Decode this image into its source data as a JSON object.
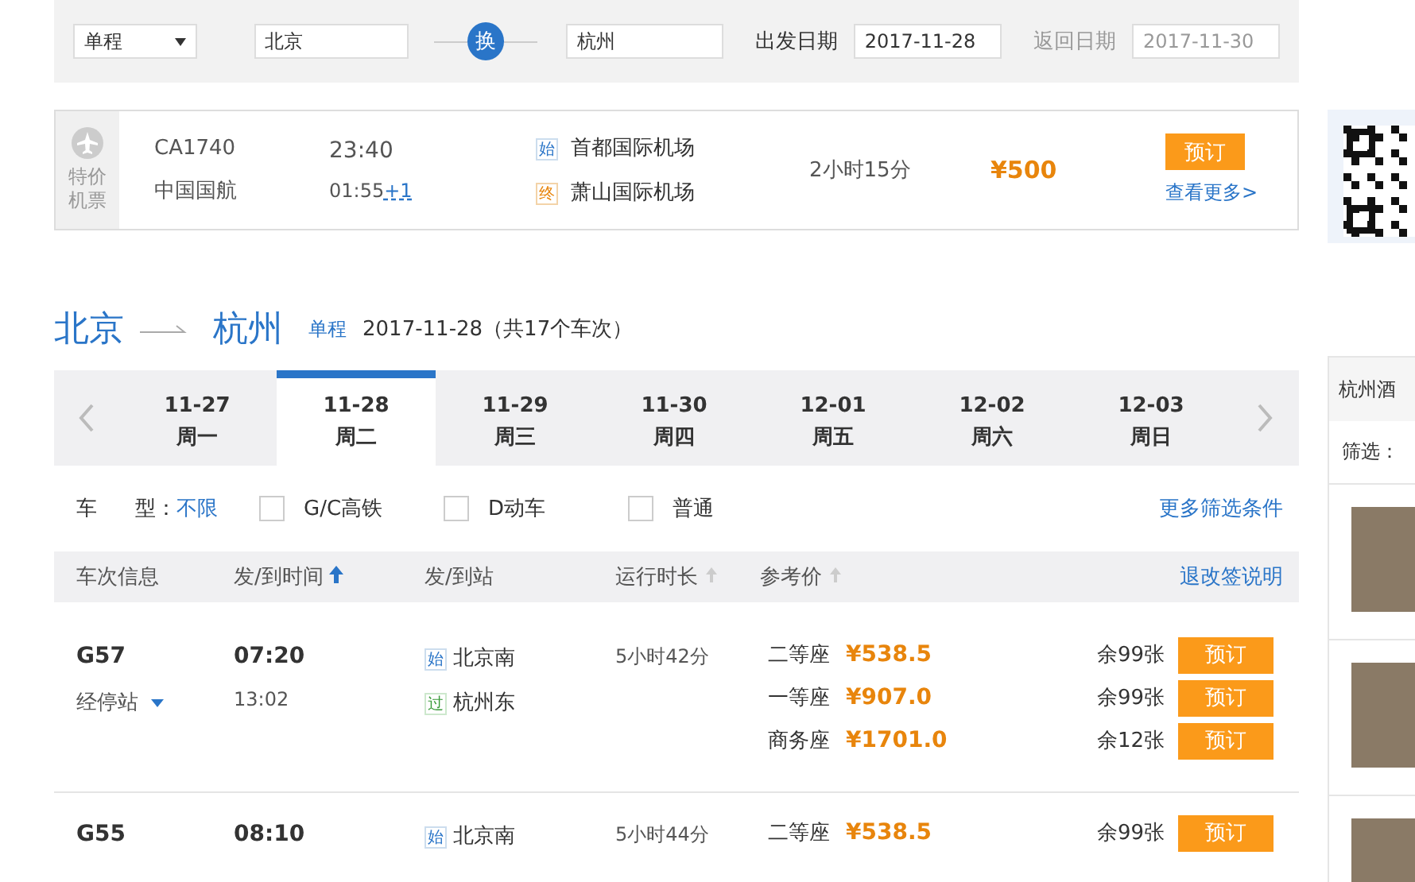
{
  "search": {
    "trip_type": "单程",
    "from": "北京",
    "swap": "换",
    "to": "杭州",
    "depart_label": "出发日期",
    "depart_date": "2017-11-28",
    "return_label": "返回日期",
    "return_date": "2017-11-30"
  },
  "flight_ad": {
    "badge": "特价机票",
    "flight_no": "CA1740",
    "airline": "中国国航",
    "depart_time": "23:40",
    "arrive_time": "01:55",
    "next_day": "+1",
    "from_tag": "始",
    "from_airport": "首都国际机场",
    "to_tag": "终",
    "to_airport": "萧山国际机场",
    "duration": "2小时15分",
    "price": "¥500",
    "book": "预订",
    "more": "查看更多>"
  },
  "route": {
    "from": "北京",
    "to": "杭州",
    "trip_type": "单程",
    "summary": "2017-11-28（共17个车次）"
  },
  "date_tabs": [
    {
      "date": "11-27",
      "weekday": "周一",
      "selected": false
    },
    {
      "date": "11-28",
      "weekday": "周二",
      "selected": true
    },
    {
      "date": "11-29",
      "weekday": "周三",
      "selected": false
    },
    {
      "date": "11-30",
      "weekday": "周四",
      "selected": false
    },
    {
      "date": "12-01",
      "weekday": "周五",
      "selected": false
    },
    {
      "date": "12-02",
      "weekday": "周六",
      "selected": false
    },
    {
      "date": "12-03",
      "weekday": "周日",
      "selected": false
    }
  ],
  "filters": {
    "label_1": "车",
    "label_2": "型：",
    "any": "不限",
    "options": [
      {
        "label": "G/C高铁",
        "checked": false
      },
      {
        "label": "D动车",
        "checked": false
      },
      {
        "label": "普通",
        "checked": false
      }
    ],
    "more": "更多筛选条件"
  },
  "table": {
    "columns": [
      {
        "label": "车次信息"
      },
      {
        "label": "发/到时间",
        "sorted": true
      },
      {
        "label": "发/到站"
      },
      {
        "label": "运行时长",
        "sorted": false
      },
      {
        "label": "参考价",
        "sorted": false
      }
    ],
    "policy": "退改签说明",
    "rows": [
      {
        "train": "G57",
        "stops": "经停站",
        "depart": "07:20",
        "arrive": "13:02",
        "stations": [
          {
            "tag": "始",
            "name": "北京南",
            "kind": "start"
          },
          {
            "tag": "过",
            "name": "杭州东",
            "kind": "pass"
          }
        ],
        "duration": "5小时42分",
        "seats": [
          {
            "seat_class": "二等座",
            "price": "¥538.5",
            "remaining": "余99张",
            "book": "预订"
          },
          {
            "seat_class": "一等座",
            "price": "¥907.0",
            "remaining": "余99张",
            "book": "预订"
          },
          {
            "seat_class": "商务座",
            "price": "¥1701.0",
            "remaining": "余12张",
            "book": "预订"
          }
        ]
      },
      {
        "train": "G55",
        "depart": "08:10",
        "stations": [
          {
            "tag": "始",
            "name": "北京南",
            "kind": "start"
          }
        ],
        "duration": "5小时44分",
        "seats": [
          {
            "seat_class": "二等座",
            "price": "¥538.5",
            "remaining": "余99张",
            "book": "预订"
          }
        ]
      }
    ]
  },
  "sidebar": {
    "title": "杭州酒",
    "filter": "筛选："
  }
}
